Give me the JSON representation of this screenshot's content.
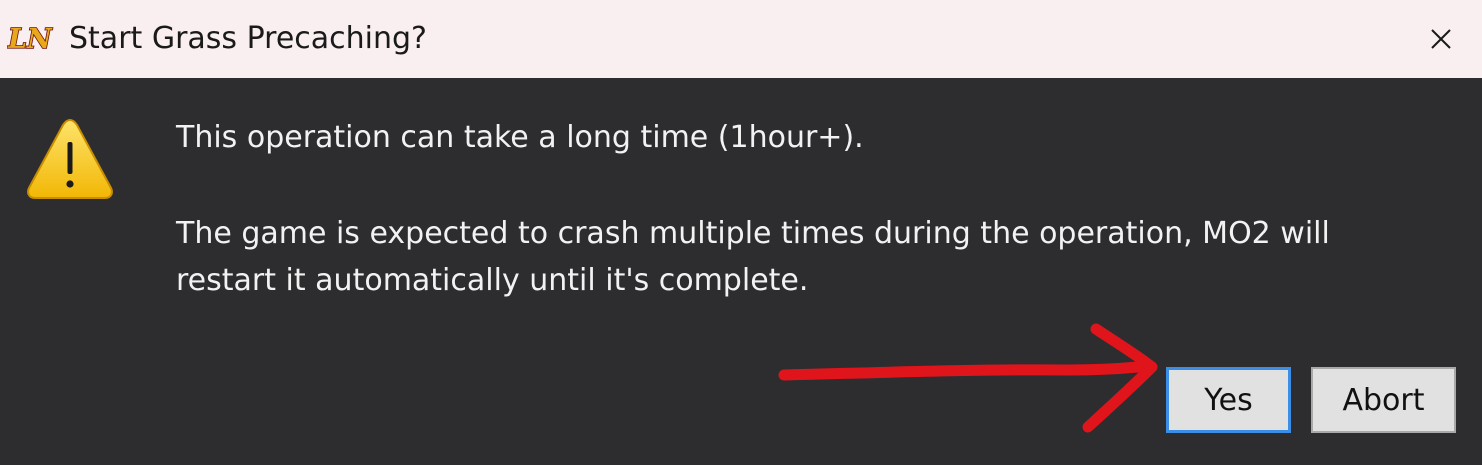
{
  "window": {
    "title": "Start Grass Precaching?",
    "app_icon_text": "LN"
  },
  "message": {
    "line1": "This operation can take a long time (1hour+).",
    "line2": "The game is expected to crash multiple times during the operation, MO2 will",
    "line3": "restart it automatically until it's complete."
  },
  "buttons": {
    "yes_label": "Yes",
    "abort_label": "Abort",
    "default": "yes"
  },
  "icons": {
    "app": "ln-app-icon",
    "warning": "warning-icon",
    "close": "close-icon"
  },
  "annotation": {
    "type": "arrow",
    "color": "#e0141b",
    "points_to": "yes-button"
  },
  "colors": {
    "titlebar_bg": "#f9eff1",
    "dialog_bg": "#2d2d30",
    "text": "#f2f2f2",
    "button_bg": "#e1e1e1",
    "focus_border": "#3a8ee6",
    "warning_fill": "#f7c91b"
  }
}
